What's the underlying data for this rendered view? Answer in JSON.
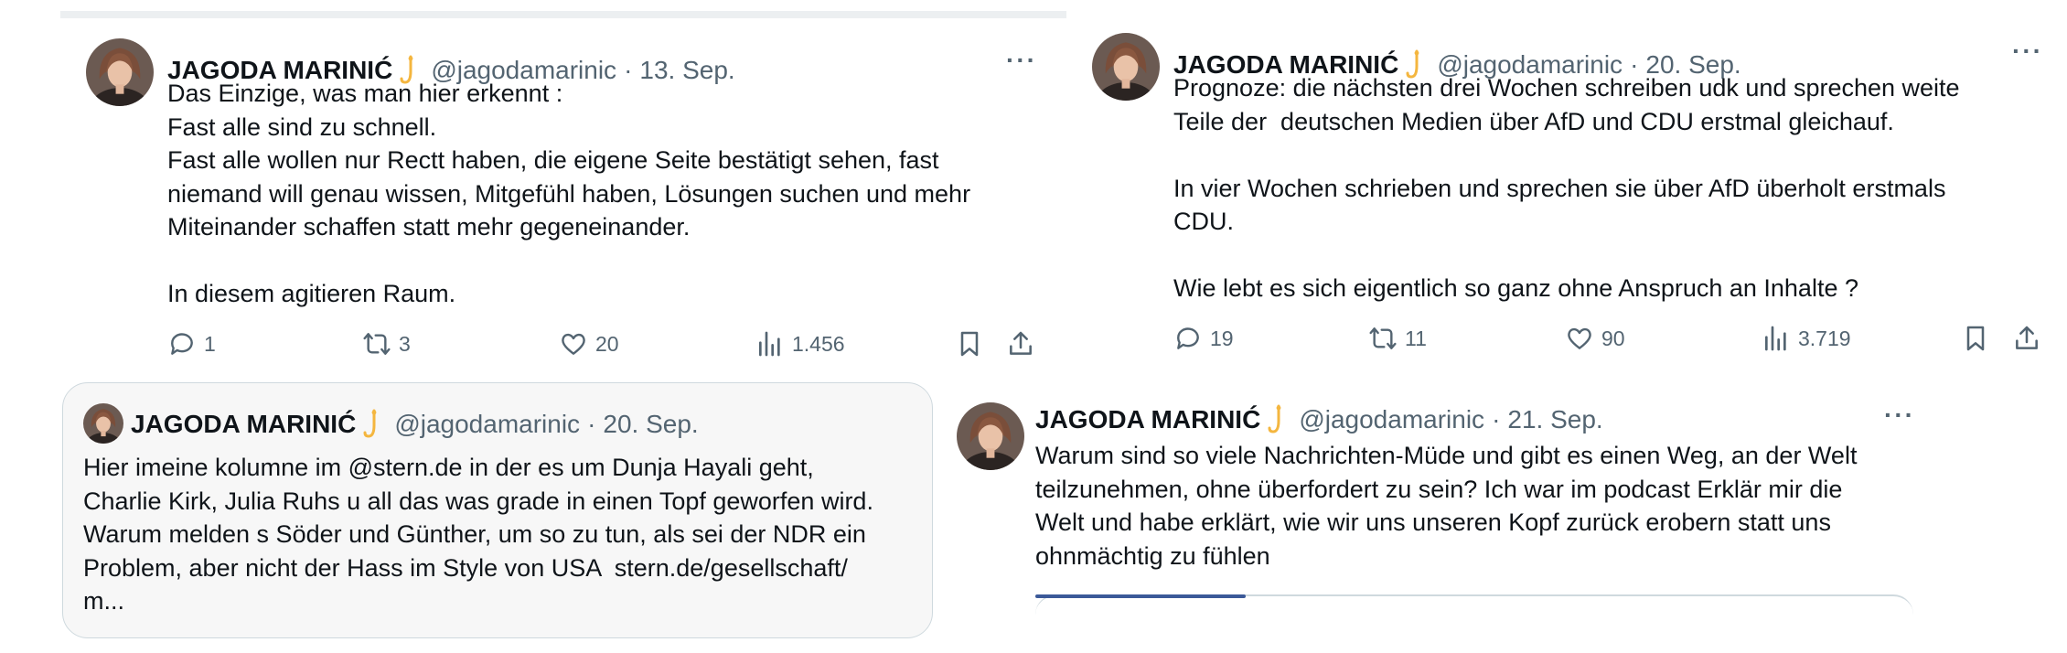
{
  "tweets": [
    {
      "author": "JAGODA MARINIĆ",
      "handle": "@jagodamarinic",
      "date": "13. Sep.",
      "text": "Das Einzige, was man hier erkennt :\nFast alle sind zu schnell.\nFast alle wollen nur Rectt haben, die eigene Seite bestätigt sehen, fast\nniemand will genau wissen, Mitgefühl haben, Lösungen suchen und mehr\nMiteinander schaffen statt mehr gegeneinander.\n\nIn diesem agitieren Raum.",
      "replies": "1",
      "reposts": "3",
      "likes": "20",
      "views": "1.456"
    },
    {
      "author": "JAGODA MARINIĆ",
      "handle": "@jagodamarinic",
      "date": "20. Sep.",
      "text": "Prognoze: die nächsten drei Wochen schreiben udk und sprechen weite\nTeile der  deutschen Medien über AfD und CDU erstmal gleichauf.\n\nIn vier Wochen schrieben und sprechen sie über AfD überholt erstmals\nCDU.\n\nWie lebt es sich eigentlich so ganz ohne Anspruch an Inhalte ?",
      "replies": "19",
      "reposts": "11",
      "likes": "90",
      "views": "3.719"
    },
    {
      "author": "JAGODA MARINIĆ",
      "handle": "@jagodamarinic",
      "date": "20. Sep.",
      "text": "Hier imeine kolumne im @stern.de in der es um Dunja Hayali geht,\nCharlie Kirk, Julia Ruhs u all das was grade in einen Topf geworfen wird.\nWarum melden s Söder und Günther, um so zu tun, als sei der NDR ein\nProblem, aber nicht der Hass im Style von USA  stern.de/gesellschaft/\nm..."
    },
    {
      "author": "JAGODA MARINIĆ",
      "handle": "@jagodamarinic",
      "date": "21. Sep.",
      "text": "Warum sind so viele Nachrichten-Müde und gibt es einen Weg, an der Welt\nteilzunehmen, ohne überfordert zu sein? Ich war im podcast Erklär mir die\nWelt und habe erklärt, wie wir uns unseren Kopf zurück erobern statt uns\nohnmächtig zu fühlen"
    }
  ],
  "icons": {
    "more": "more-icon",
    "reply": "reply-icon",
    "repost": "repost-icon",
    "like": "like-icon",
    "views": "views-icon",
    "bookmark": "bookmark-icon",
    "share": "share-icon",
    "badge": "badge-icon"
  },
  "colors": {
    "text": "#0f1419",
    "secondary": "#536471",
    "border": "#cfd9de",
    "badge": "#f4b63f",
    "quote_bg": "#f7f7f7"
  }
}
